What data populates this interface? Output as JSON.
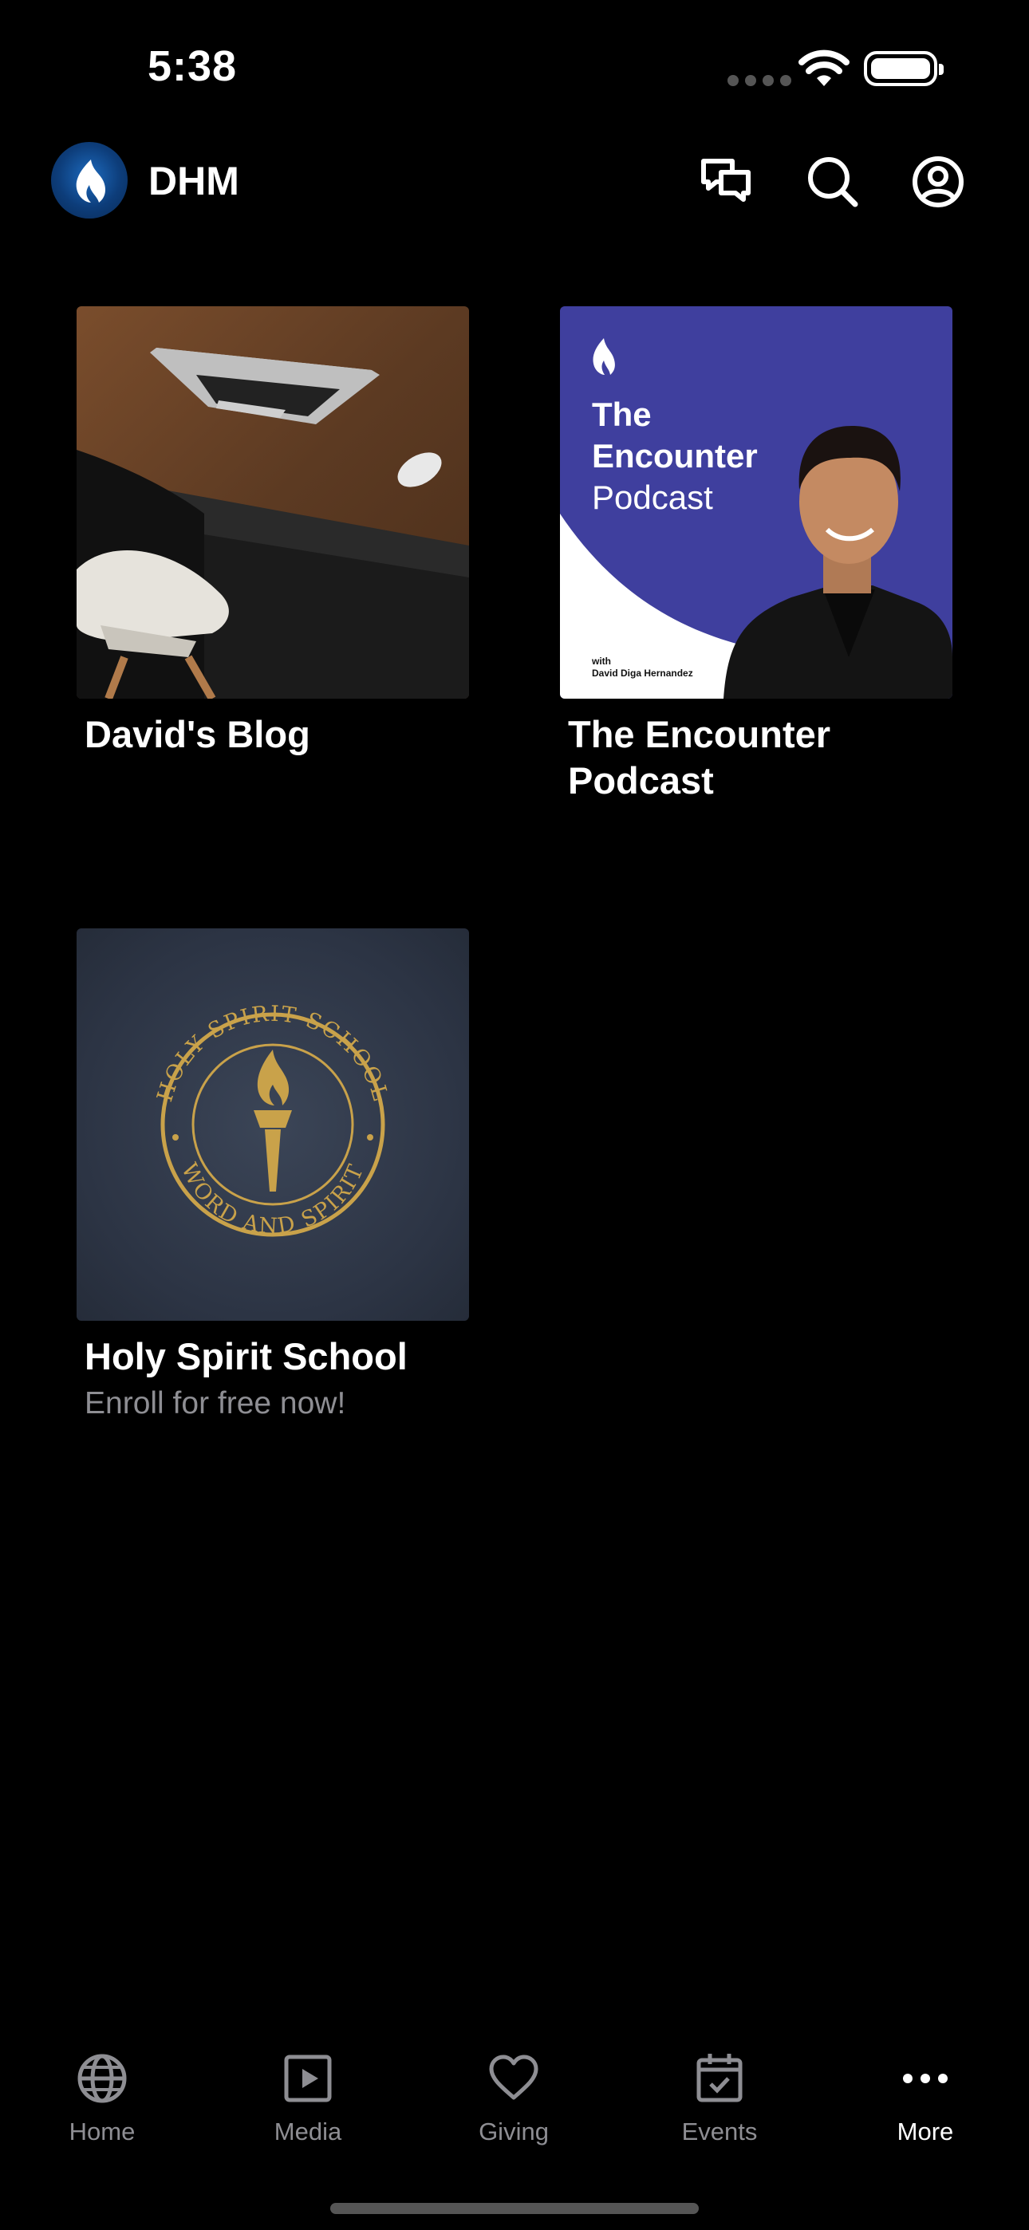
{
  "status": {
    "time": "5:38"
  },
  "header": {
    "brand": "DHM",
    "icons": [
      "chat-icon",
      "search-icon",
      "profile-icon"
    ]
  },
  "cards": [
    {
      "title": "David's Blog",
      "subtitle": "",
      "image": "laptop-desk-photo"
    },
    {
      "title": "The Encounter Podcast",
      "subtitle": "",
      "image": "podcast-cover",
      "cover": {
        "line1": "The",
        "line2": "Encounter",
        "line3": "Podcast",
        "with": "with",
        "host": "David Diga Hernandez"
      }
    },
    {
      "title": "Holy Spirit School",
      "subtitle": "Enroll for free now!",
      "image": "school-seal",
      "seal": {
        "top": "HOLY SPIRIT SCHOOL",
        "bottom": "WORD AND SPIRIT"
      }
    }
  ],
  "tabs": [
    {
      "label": "Home",
      "icon": "globe-icon",
      "active": false
    },
    {
      "label": "Media",
      "icon": "play-icon",
      "active": false
    },
    {
      "label": "Giving",
      "icon": "heart-icon",
      "active": false
    },
    {
      "label": "Events",
      "icon": "calendar-icon",
      "active": false
    },
    {
      "label": "More",
      "icon": "more-icon",
      "active": true
    }
  ],
  "colors": {
    "background": "#000000",
    "inactive": "#8e8e93",
    "podcast_purple": "#3f3f9e",
    "gold": "#c9a24a"
  }
}
